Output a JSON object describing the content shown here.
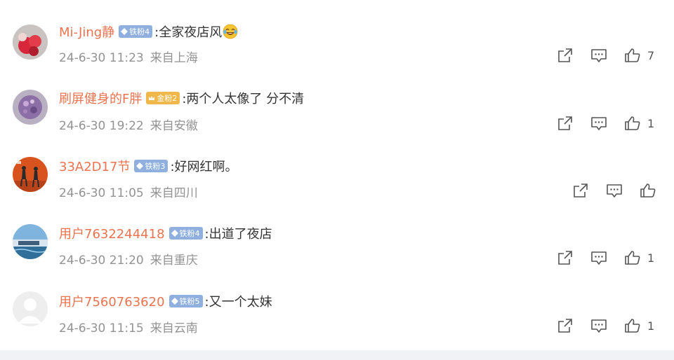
{
  "comments": [
    {
      "username": "Mi-Jing静",
      "badge": "铁粉4",
      "badge_type": "iron",
      "text": ":全家夜店风",
      "emoji": "grinning-tears-emoji",
      "date": "24-6-30 11:23",
      "location": "来自上海",
      "likes": "7"
    },
    {
      "username": "刷屏健身的F胖",
      "badge": "金粉2",
      "badge_type": "gold",
      "text": ":两个人太像了 分不清",
      "date": "24-6-30 19:22",
      "location": "来自安徽",
      "likes": "1"
    },
    {
      "username": "33A2D17节",
      "badge": "铁粉3",
      "badge_type": "iron",
      "text": ":好网红啊。",
      "date": "24-6-30 11:05",
      "location": "来自四川",
      "likes": ""
    },
    {
      "username": "用户7632244418",
      "badge": "铁粉4",
      "badge_type": "iron",
      "text": ":出道了夜店",
      "date": "24-6-30 21:20",
      "location": "来自重庆",
      "likes": "1"
    },
    {
      "username": "用户7560763620",
      "badge": "铁粉5",
      "badge_type": "iron",
      "text": ":又一个太妹",
      "date": "24-6-30 11:15",
      "location": "来自云南",
      "likes": "1"
    }
  ],
  "icons": {
    "share": "share-icon",
    "reply": "comment-icon",
    "like": "thumbs-up-icon"
  },
  "colors": {
    "username": "#eb7350",
    "meta": "#939393",
    "iron_badge": "#8fb0df",
    "gold_badge": "#f0b84a"
  }
}
